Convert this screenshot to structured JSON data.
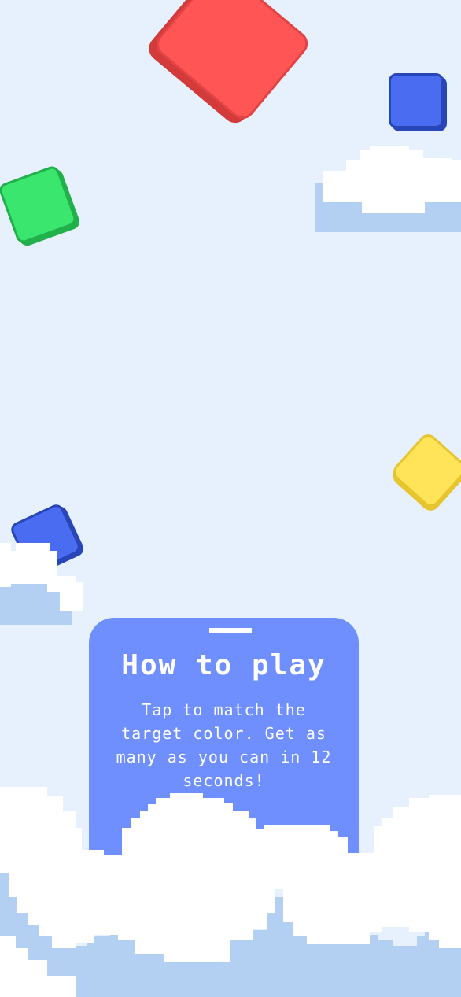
{
  "tiles": [
    {
      "name": "red-tile-icon",
      "color": "#ff5555",
      "shadow": "#d33a3a",
      "border": "#e04444"
    },
    {
      "name": "blue-tile-icon",
      "color": "#4a6cf0",
      "shadow": "#2946b8",
      "border": "#2946b8"
    },
    {
      "name": "green-tile-icon",
      "color": "#3be66f",
      "shadow": "#22b04a",
      "border": "#22b04a"
    },
    {
      "name": "yellow-tile-icon",
      "color": "#ffe359",
      "shadow": "#e6c52f",
      "border": "#e6c52f"
    }
  ],
  "how_to_play": {
    "title": "How to play",
    "body": "Tap to match the target color. Get as many as you can in 12 seconds!"
  },
  "colors": {
    "background": "#e7f1fe",
    "card": "#6e8ffd",
    "cloud": "#ffffff",
    "cloud_shadow": "#b3cff1"
  }
}
